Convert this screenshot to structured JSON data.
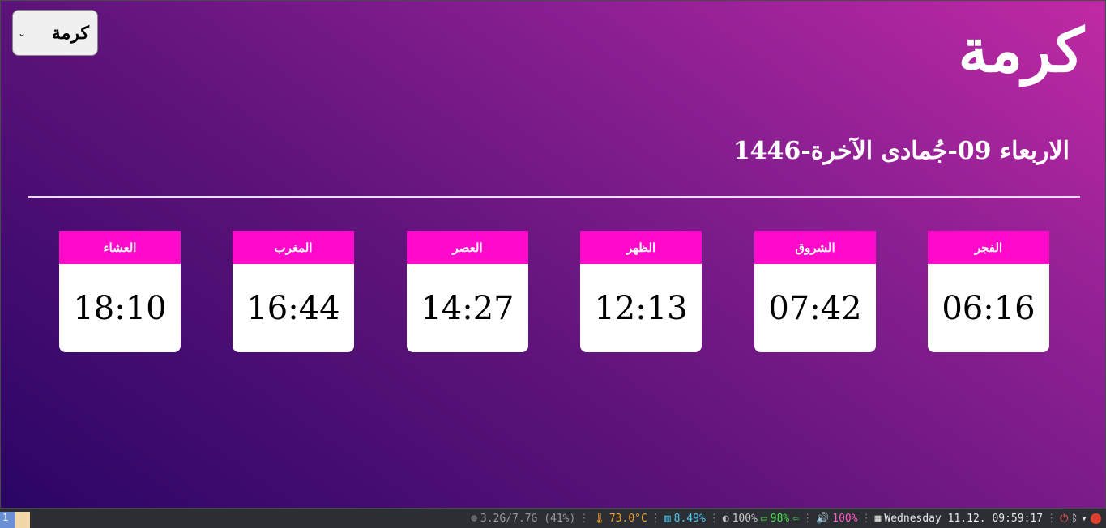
{
  "city_select": {
    "value": "كرمة",
    "chevron_icon": "chevron-down-icon"
  },
  "city_title": "كرمة",
  "date_line": "الاربعاء 09-جُمادى الآخرة-1446",
  "prayers": [
    {
      "name": "الفجر",
      "time": "06:16"
    },
    {
      "name": "الشروق",
      "time": "07:42"
    },
    {
      "name": "الظهر",
      "time": "12:13"
    },
    {
      "name": "العصر",
      "time": "14:27"
    },
    {
      "name": "المغرب",
      "time": "16:44"
    },
    {
      "name": "العشاء",
      "time": "18:10"
    }
  ],
  "colors": {
    "card_header": "#ff0acb",
    "gradient_start": "#2a0566",
    "gradient_end": "#c02aa4"
  },
  "statusbar": {
    "workspace": "1",
    "memory": "3.2G/7.7G (41%)",
    "temperature": "73.0°C",
    "cpu": "8.49%",
    "brightness": "100%",
    "battery": "98%",
    "volume": "100%",
    "datetime": "Wednesday 11.12. 09:59:17"
  }
}
